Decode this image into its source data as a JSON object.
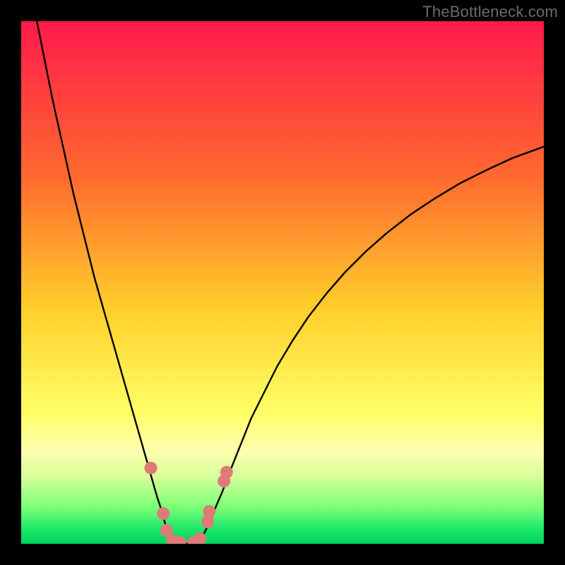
{
  "watermark": "TheBottleneck.com",
  "chart_data": {
    "type": "line",
    "title": "",
    "xlabel": "",
    "ylabel": "",
    "xlim": [
      0,
      100
    ],
    "ylim": [
      0,
      100
    ],
    "grid": false,
    "legend": false,
    "gradient_stops": [
      {
        "offset": 0.0,
        "color": "#ff1a4b"
      },
      {
        "offset": 0.3,
        "color": "#ff6a2f"
      },
      {
        "offset": 0.55,
        "color": "#ffcf2a"
      },
      {
        "offset": 0.75,
        "color": "#ffff66"
      },
      {
        "offset": 0.82,
        "color": "#ffffb0"
      },
      {
        "offset": 0.87,
        "color": "#d8ff9a"
      },
      {
        "offset": 0.93,
        "color": "#7cff77"
      },
      {
        "offset": 0.97,
        "color": "#20e86b"
      },
      {
        "offset": 1.0,
        "color": "#00d45e"
      }
    ],
    "series": [
      {
        "name": "left-branch",
        "stroke": "#000000",
        "x": [
          3,
          4,
          5,
          6,
          7,
          8,
          9,
          10,
          11,
          12,
          13,
          14,
          15,
          16,
          17,
          18,
          19,
          20,
          21,
          22,
          23,
          24,
          25,
          26,
          27,
          27.5,
          28,
          28.5,
          29
        ],
        "y": [
          100,
          95,
          90,
          85,
          80.5,
          76,
          71.5,
          67,
          63,
          59,
          55,
          51,
          47.5,
          44,
          40.5,
          37,
          33.5,
          30,
          26.5,
          23,
          19.5,
          16,
          12.5,
          9,
          6,
          4,
          2.5,
          1.3,
          0.5
        ]
      },
      {
        "name": "right-branch",
        "stroke": "#000000",
        "x": [
          34,
          35,
          36,
          37,
          38.5,
          40,
          42,
          44,
          46.5,
          49,
          52,
          55,
          58.5,
          62,
          66,
          70,
          74.5,
          79,
          84,
          89,
          94,
          100
        ],
        "y": [
          0.5,
          2,
          4,
          6.5,
          10,
          14,
          19,
          24,
          29,
          34,
          39,
          43.5,
          48,
          52,
          56,
          59.5,
          63,
          66,
          69,
          71.5,
          73.8,
          76
        ]
      },
      {
        "name": "valley-floor",
        "stroke": "#000000",
        "x": [
          29,
          30,
          31,
          32,
          33,
          34
        ],
        "y": [
          0.5,
          0.15,
          0.05,
          0.05,
          0.15,
          0.5
        ]
      }
    ],
    "dots": {
      "name": "sample-points",
      "color": "#e07a78",
      "r": 9,
      "points": [
        {
          "x": 24.8,
          "y": 14.5
        },
        {
          "x": 27.2,
          "y": 5.8
        },
        {
          "x": 27.8,
          "y": 2.6
        },
        {
          "x": 29.0,
          "y": 0.6
        },
        {
          "x": 30.4,
          "y": 0.25
        },
        {
          "x": 33.0,
          "y": 0.25
        },
        {
          "x": 34.2,
          "y": 1.0
        },
        {
          "x": 35.7,
          "y": 4.2
        },
        {
          "x": 36.0,
          "y": 6.2
        },
        {
          "x": 38.8,
          "y": 12.0
        },
        {
          "x": 39.3,
          "y": 13.7
        }
      ]
    }
  }
}
